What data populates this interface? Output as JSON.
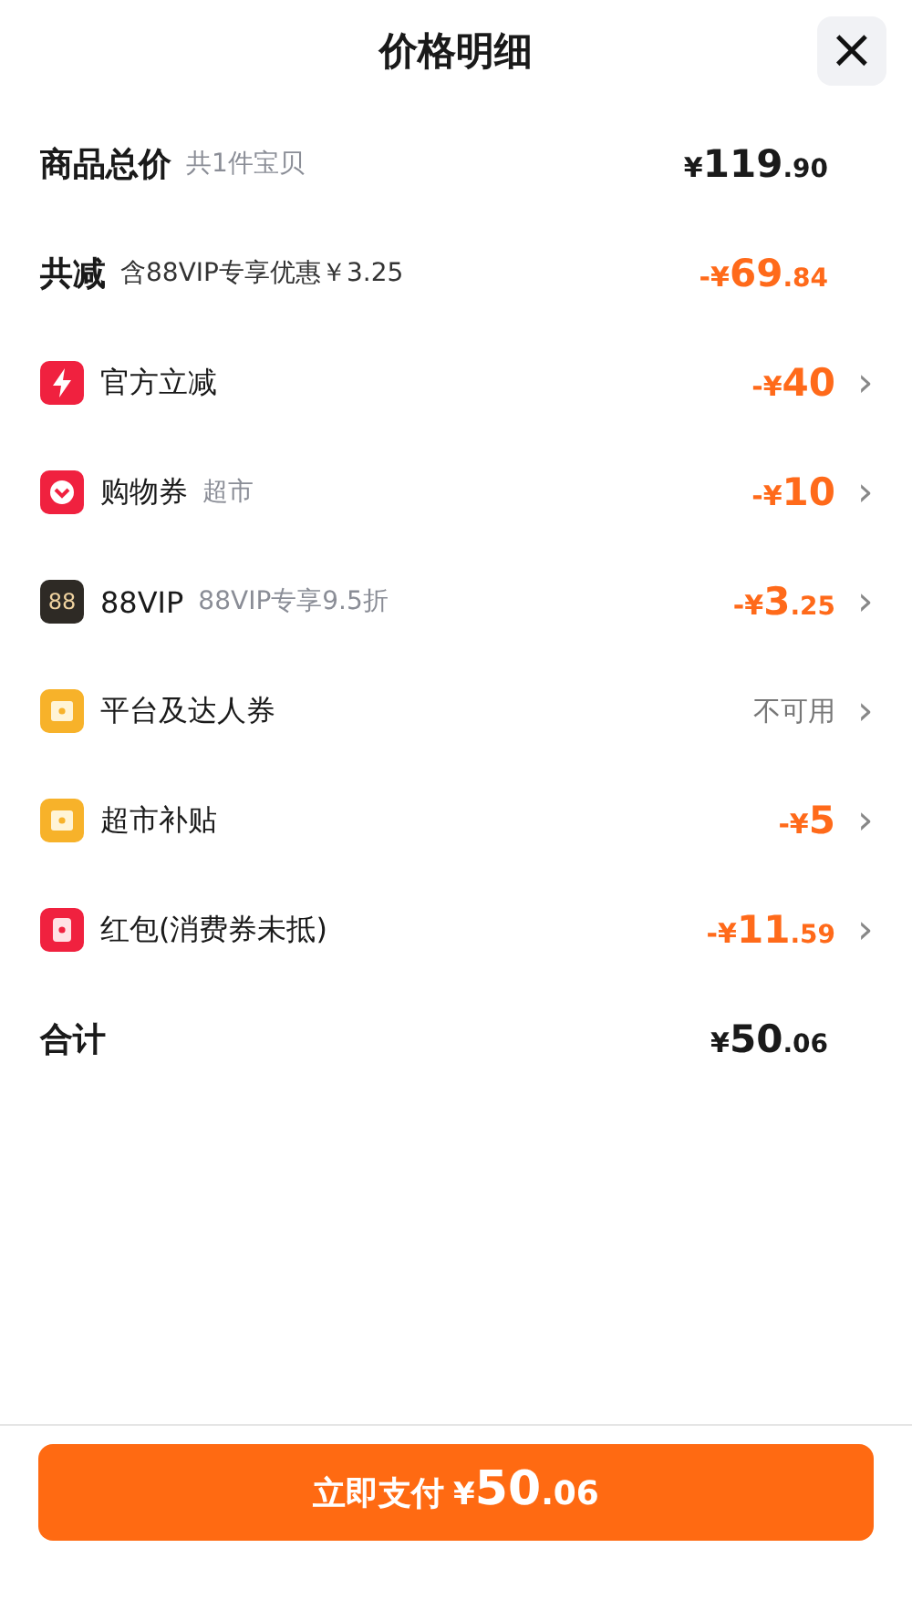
{
  "header": {
    "title": "价格明细",
    "close": "×"
  },
  "rows": [
    {
      "kind": "summary",
      "label": "商品总价",
      "note": "共1件宝贝",
      "amount": {
        "kind": "price",
        "discount": false,
        "prefix": "¥",
        "main": "119",
        "cents": ".90"
      }
    },
    {
      "kind": "summary",
      "label": "共减",
      "note": "含88VIP专享优惠￥3.25",
      "amount": {
        "kind": "price",
        "discount": true,
        "prefix": "-¥",
        "main": "69",
        "cents": ".84"
      }
    },
    {
      "kind": "bolt",
      "label": "官方立减",
      "amount": {
        "kind": "price",
        "discount": true,
        "prefix": "-¥",
        "main": "40"
      },
      "chevron": "›"
    },
    {
      "kind": "coupon",
      "label": "购物券",
      "note": "超市",
      "amount": {
        "kind": "price",
        "discount": true,
        "prefix": "-¥",
        "main": "10"
      },
      "chevron": "›"
    },
    {
      "kind": "vip",
      "icon_text": "88",
      "label": "88VIP",
      "note": "88VIP专享9.5折",
      "amount": {
        "kind": "price",
        "discount": true,
        "prefix": "-¥",
        "main": "3",
        "cents": ".25"
      },
      "chevron": "›"
    },
    {
      "kind": "ticket",
      "label": "平台及达人券",
      "amount": {
        "kind": "status",
        "text": "不可用"
      },
      "chevron": "›"
    },
    {
      "kind": "ticket",
      "label": "超市补贴",
      "amount": {
        "kind": "price",
        "discount": true,
        "prefix": "-¥",
        "main": "5"
      },
      "chevron": "›"
    },
    {
      "kind": "envelope",
      "label": "红包(消费券未抵)",
      "amount": {
        "kind": "price",
        "discount": true,
        "prefix": "-¥",
        "main": "11",
        "cents": ".59"
      },
      "chevron": "›"
    },
    {
      "kind": "summary",
      "label": "合计",
      "amount": {
        "kind": "price",
        "discount": false,
        "prefix": "¥",
        "main": "50",
        "cents": ".06"
      }
    }
  ],
  "pay_button": {
    "label": "立即支付",
    "prefix": "¥",
    "main": "50",
    "cents": ".06"
  }
}
